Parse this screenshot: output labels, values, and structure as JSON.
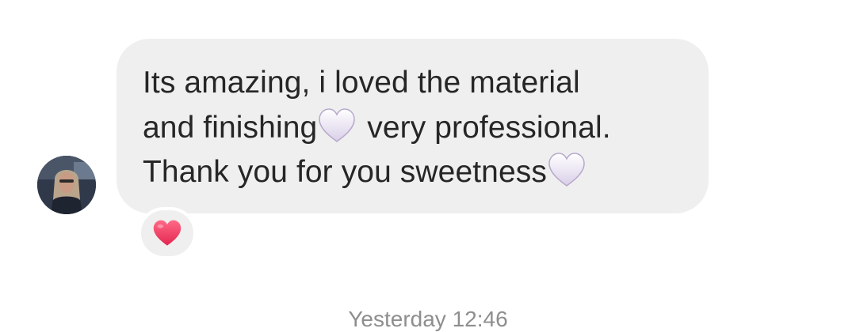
{
  "message": {
    "line1": "Its amazing, i loved the material",
    "line2_before": "and finishing",
    "line2_after": " very professional.",
    "line3": "Thank you for you sweetness",
    "emoji": "white-heart-icon"
  },
  "reaction": {
    "emoji": "red-heart-icon"
  },
  "timestamp": "Yesterday 12:46",
  "colors": {
    "bubble": "#efefef",
    "text": "#262626",
    "reaction_heart": "#f0445f",
    "timestamp": "#8e8e8e"
  }
}
